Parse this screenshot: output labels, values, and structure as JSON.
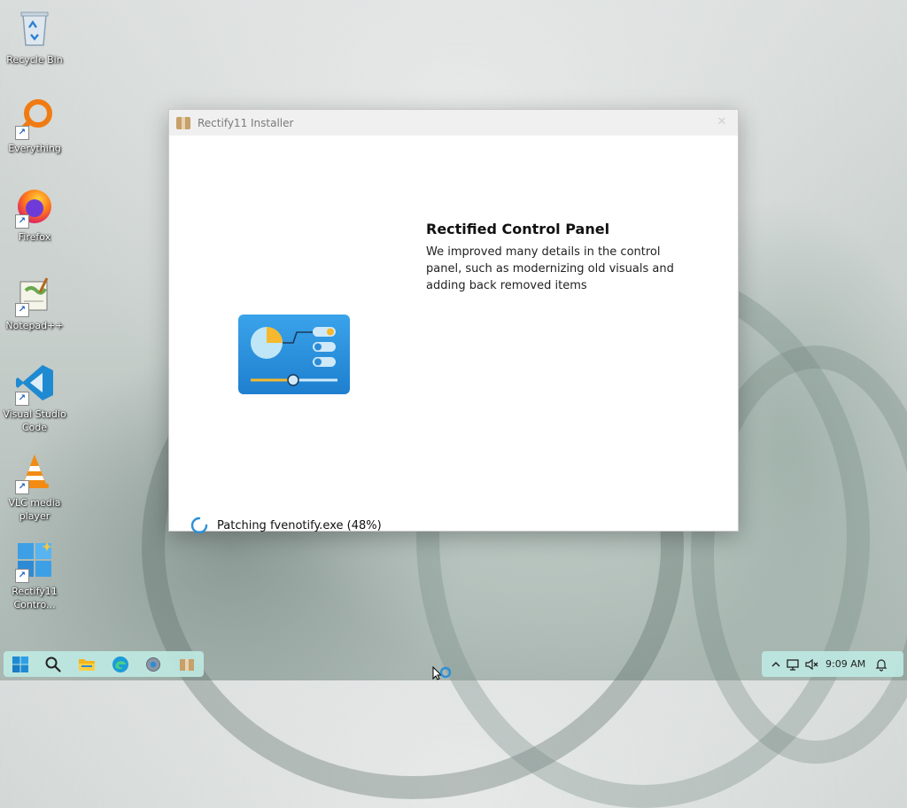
{
  "desktop": {
    "icons": [
      {
        "label": "Recycle Bin",
        "icon": "recycle-bin-icon",
        "shortcut": false
      },
      {
        "label": "Everything",
        "icon": "everything-search-icon",
        "shortcut": true
      },
      {
        "label": "Firefox",
        "icon": "firefox-icon",
        "shortcut": true
      },
      {
        "label": "Notepad++",
        "icon": "notepadpp-icon",
        "shortcut": true
      },
      {
        "label": "Visual Studio Code",
        "icon": "vscode-icon",
        "shortcut": true
      },
      {
        "label": "VLC media player",
        "icon": "vlc-icon",
        "shortcut": true
      },
      {
        "label": "Rectify11 Contro...",
        "icon": "rectify11-icon",
        "shortcut": true
      }
    ]
  },
  "window": {
    "title": "Rectify11 Installer",
    "close_glyph": "✕",
    "feature": {
      "title": "Rectified Control Panel",
      "description": "We improved many details in the control panel, such as modernizing old visuals and adding back removed items"
    },
    "status": {
      "text": "Patching fvenotify.exe (48%)",
      "progress_percent": 48
    }
  },
  "taskbar": {
    "items": [
      {
        "icon": "start-icon"
      },
      {
        "icon": "search-icon"
      },
      {
        "icon": "file-explorer-icon"
      },
      {
        "icon": "edge-icon"
      },
      {
        "icon": "settings-icon"
      },
      {
        "icon": "installer-icon"
      }
    ],
    "tray": {
      "clock": "9:09 AM",
      "icons": [
        "chevron-up-icon",
        "network-icon",
        "volume-muted-icon",
        "notification-bell-icon"
      ]
    }
  },
  "colors": {
    "accent": "#2b8fd8",
    "taskbar": "#bee8e2"
  }
}
